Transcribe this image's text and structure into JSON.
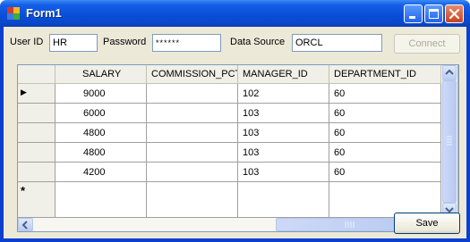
{
  "window": {
    "title": "Form1"
  },
  "form": {
    "user_id_label": "User ID",
    "user_id_value": "HR",
    "password_label": "Password",
    "password_value": "******",
    "data_source_label": "Data Source",
    "data_source_value": "ORCL",
    "connect_label": "Connect",
    "save_label": "Save"
  },
  "grid": {
    "columns": [
      "SALARY",
      "COMMISSION_PCT",
      "MANAGER_ID",
      "DEPARTMENT_ID"
    ],
    "rows": [
      [
        "9000",
        "",
        "102",
        "60"
      ],
      [
        "6000",
        "",
        "103",
        "60"
      ],
      [
        "4800",
        "",
        "103",
        "60"
      ],
      [
        "4800",
        "",
        "103",
        "60"
      ],
      [
        "4200",
        "",
        "103",
        "60"
      ]
    ],
    "current_row_marker": "▶",
    "new_row_marker": "*"
  },
  "icons": {
    "app": "form-app-icon",
    "minimize": "minimize-icon",
    "maximize": "maximize-icon",
    "close": "close-icon"
  },
  "colors": {
    "title_bar": "#0a4fd8",
    "client_background": "#ece9d8",
    "grid_background": "#aba9a1"
  }
}
